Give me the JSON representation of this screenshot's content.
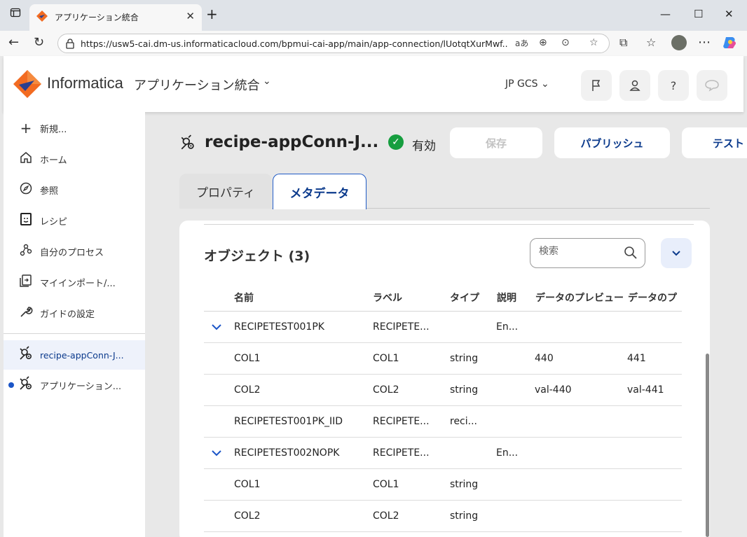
{
  "browser": {
    "tab_title": "アプリケーション統合",
    "url": "https://usw5-cai.dm-us.informaticacloud.com/bpmui-cai-app/main/app-connection/lUotqtXurMwf..."
  },
  "header": {
    "brand": "Informatica",
    "app_name": "アプリケーション統合",
    "org": "JP GCS"
  },
  "sidebar": {
    "items": [
      {
        "label": "新規...",
        "icon": "plus-icon"
      },
      {
        "label": "ホーム",
        "icon": "home-icon"
      },
      {
        "label": "参照",
        "icon": "compass-icon"
      },
      {
        "label": "レシピ",
        "icon": "recipe-icon"
      },
      {
        "label": "自分のプロセス",
        "icon": "process-icon"
      },
      {
        "label": "マイインポート/...",
        "icon": "import-icon"
      },
      {
        "label": "ガイドの設定",
        "icon": "wrench-icon"
      },
      {
        "label": "recipe-appConn-J...",
        "icon": "app-connection-icon"
      },
      {
        "label": "アプリケーション...",
        "icon": "app-connection-icon"
      }
    ]
  },
  "main": {
    "title": "recipe-appConn-J...",
    "status": "有効",
    "buttons": {
      "save": "保存",
      "publish": "パブリッシュ",
      "test": "テスト"
    },
    "tabs": {
      "properties": "プロパティ",
      "metadata": "メタデータ"
    },
    "objects_title": "オブジェクト (3)",
    "search_placeholder": "検索",
    "columns": [
      "名前",
      "ラベル",
      "タイプ",
      "説明",
      "データのプレビュー",
      "データのプ"
    ],
    "rows": [
      {
        "expandable": true,
        "name": "RECIPETEST001PK",
        "label": "RECIPETE...",
        "type": "",
        "desc": "En...",
        "preview1": "",
        "preview2": ""
      },
      {
        "expandable": false,
        "name": "COL1",
        "label": "COL1",
        "type": "string",
        "desc": "",
        "preview1": "440",
        "preview2": "441"
      },
      {
        "expandable": false,
        "name": "COL2",
        "label": "COL2",
        "type": "string",
        "desc": "",
        "preview1": "val-440",
        "preview2": "val-441"
      },
      {
        "expandable": false,
        "name": "RECIPETEST001PK_IID",
        "label": "RECIPETE...",
        "type": "reci...",
        "desc": "",
        "preview1": "",
        "preview2": ""
      },
      {
        "expandable": true,
        "name": "RECIPETEST002NOPK",
        "label": "RECIPETE...",
        "type": "",
        "desc": "En...",
        "preview1": "",
        "preview2": ""
      },
      {
        "expandable": false,
        "name": "COL1",
        "label": "COL1",
        "type": "string",
        "desc": "",
        "preview1": "",
        "preview2": ""
      },
      {
        "expandable": false,
        "name": "COL2",
        "label": "COL2",
        "type": "string",
        "desc": "",
        "preview1": "",
        "preview2": ""
      }
    ]
  },
  "colors": {
    "accent": "#0b3a8c",
    "status_ok": "#169e3f",
    "brand_orange": "#f26b21"
  }
}
